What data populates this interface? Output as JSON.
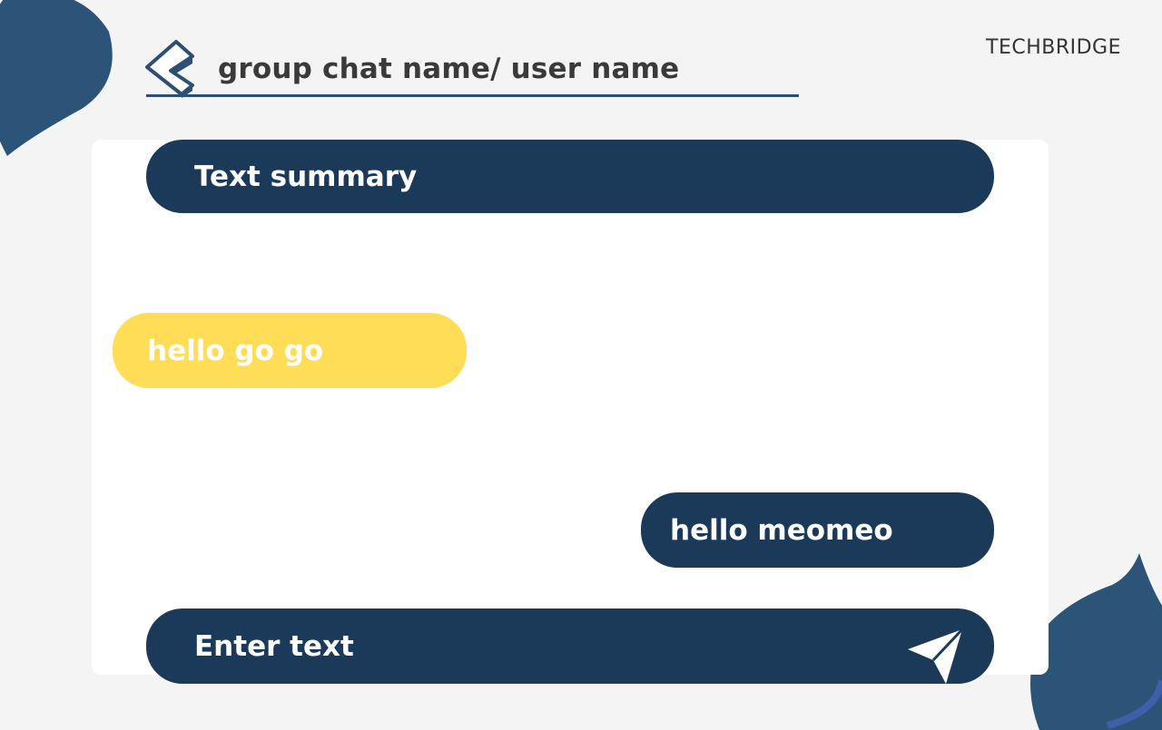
{
  "colors": {
    "background": "#f4f4f4",
    "card": "#ffffff",
    "navy": "#1b3a5a",
    "blob": "#2c5378",
    "accent_yellow": "#ffdd57",
    "text_light": "#ffffff",
    "text_dark": "#3a3a3a"
  },
  "header": {
    "back_icon": "chevron-left-icon",
    "title": "group chat name/ user name",
    "brand": "TECHBRIDGE"
  },
  "chat": {
    "summary_label": "Text summary",
    "messages": [
      {
        "text": "hello go go",
        "direction": "incoming"
      },
      {
        "text": "hello meomeo",
        "direction": "outgoing"
      }
    ]
  },
  "composer": {
    "placeholder": "Enter text",
    "send_icon": "send-icon"
  }
}
